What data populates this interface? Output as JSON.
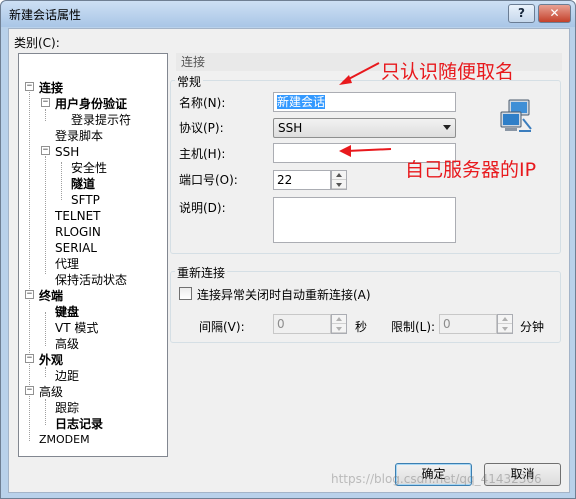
{
  "window": {
    "title": "新建会话属性",
    "help_label": "?",
    "close_label": "✕"
  },
  "category_label": "类别(C):",
  "tree": [
    {
      "label": "连接",
      "bold": true
    },
    {
      "label": "用户身份验证",
      "bold": true
    },
    {
      "label": "登录提示符",
      "bold": false
    },
    {
      "label": "登录脚本",
      "bold": false
    },
    {
      "label": "SSH",
      "bold": false
    },
    {
      "label": "安全性",
      "bold": false
    },
    {
      "label": "隧道",
      "bold": true
    },
    {
      "label": "SFTP",
      "bold": false
    },
    {
      "label": "TELNET",
      "bold": false
    },
    {
      "label": "RLOGIN",
      "bold": false
    },
    {
      "label": "SERIAL",
      "bold": false
    },
    {
      "label": "代理",
      "bold": false
    },
    {
      "label": "保持活动状态",
      "bold": false
    },
    {
      "label": "终端",
      "bold": true
    },
    {
      "label": "键盘",
      "bold": true
    },
    {
      "label": "VT 模式",
      "bold": false
    },
    {
      "label": "高级",
      "bold": false
    },
    {
      "label": "外观",
      "bold": true
    },
    {
      "label": "边距",
      "bold": false
    },
    {
      "label": "高级",
      "bold": false
    },
    {
      "label": "跟踪",
      "bold": false
    },
    {
      "label": "日志记录",
      "bold": true
    },
    {
      "label": "ZMODEM",
      "bold": false
    }
  ],
  "section_title": "连接",
  "general": {
    "group_label": "常规",
    "name_label": "名称(N):",
    "name_value": "新建会话",
    "protocol_label": "协议(P):",
    "protocol_value": "SSH",
    "host_label": "主机(H):",
    "host_value": "",
    "port_label": "端口号(O):",
    "port_value": "22",
    "desc_label": "说明(D):",
    "desc_value": ""
  },
  "reconnect": {
    "group_label": "重新连接",
    "checkbox_label": "连接异常关闭时自动重新连接(A)",
    "interval_label": "间隔(V):",
    "interval_value": "0",
    "interval_unit": "秒",
    "limit_label": "限制(L):",
    "limit_value": "0",
    "limit_unit": "分钟"
  },
  "buttons": {
    "ok": "确定",
    "cancel": "取消"
  },
  "annotations": {
    "name_note": "只认识随便取名",
    "host_note": "自己服务器的IP"
  },
  "watermark": "https://blog.csdn.net/qq_41432366",
  "colors": {
    "annotation": "#e8191d",
    "selection": "#3399ff"
  }
}
